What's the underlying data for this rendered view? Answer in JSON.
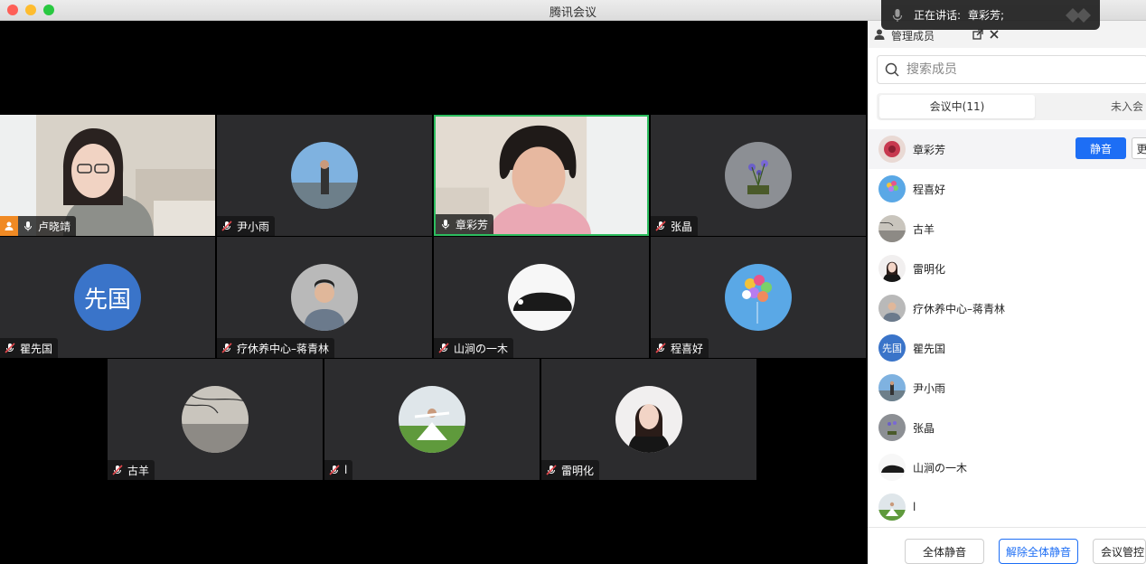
{
  "window": {
    "title": "腾讯会议"
  },
  "speaking_toast": {
    "label": "正在讲话:",
    "names": "章彩芳;"
  },
  "video_tiles": [
    {
      "name": "卢晓靖",
      "host": true,
      "mic": "on"
    },
    {
      "name": "尹小雨",
      "mic": "muted"
    },
    {
      "name": "章彩芳",
      "mic": "on",
      "speaking": true
    },
    {
      "name": "张晶",
      "mic": "muted"
    },
    {
      "name": "瞿先国",
      "mic": "muted",
      "avatar_text": "先国"
    },
    {
      "name": "疗休养中心–蒋青林",
      "mic": "muted"
    },
    {
      "name": "山涧の一木",
      "mic": "muted"
    },
    {
      "name": "程喜好",
      "mic": "muted"
    },
    {
      "name": "古羊",
      "mic": "muted"
    },
    {
      "name": "l",
      "mic": "muted"
    },
    {
      "name": "雷明化",
      "mic": "muted"
    }
  ],
  "panel": {
    "title": "管理成员",
    "search_placeholder": "搜索成员",
    "tab_in_meeting": "会议中(11)",
    "tab_not_joined": "未入会",
    "members": [
      {
        "name": "章彩芳",
        "action": "静音",
        "more": "更"
      },
      {
        "name": "程喜好"
      },
      {
        "name": "古羊"
      },
      {
        "name": "雷明化"
      },
      {
        "name": "疗休养中心–蒋青林"
      },
      {
        "name": "瞿先国",
        "avatar_text": "先国"
      },
      {
        "name": "尹小雨"
      },
      {
        "name": "张晶"
      },
      {
        "name": "山涧の一木"
      },
      {
        "name": "l"
      }
    ],
    "buttons": {
      "mute_all": "全体静音",
      "unmute_all": "解除全体静音",
      "meeting_control": "会议管控"
    }
  },
  "colors": {
    "accent": "#1d6ef5",
    "speaking_border": "#2dbd5f",
    "host_badge": "#f08a24",
    "tile_bg": "#2c2c2e"
  }
}
